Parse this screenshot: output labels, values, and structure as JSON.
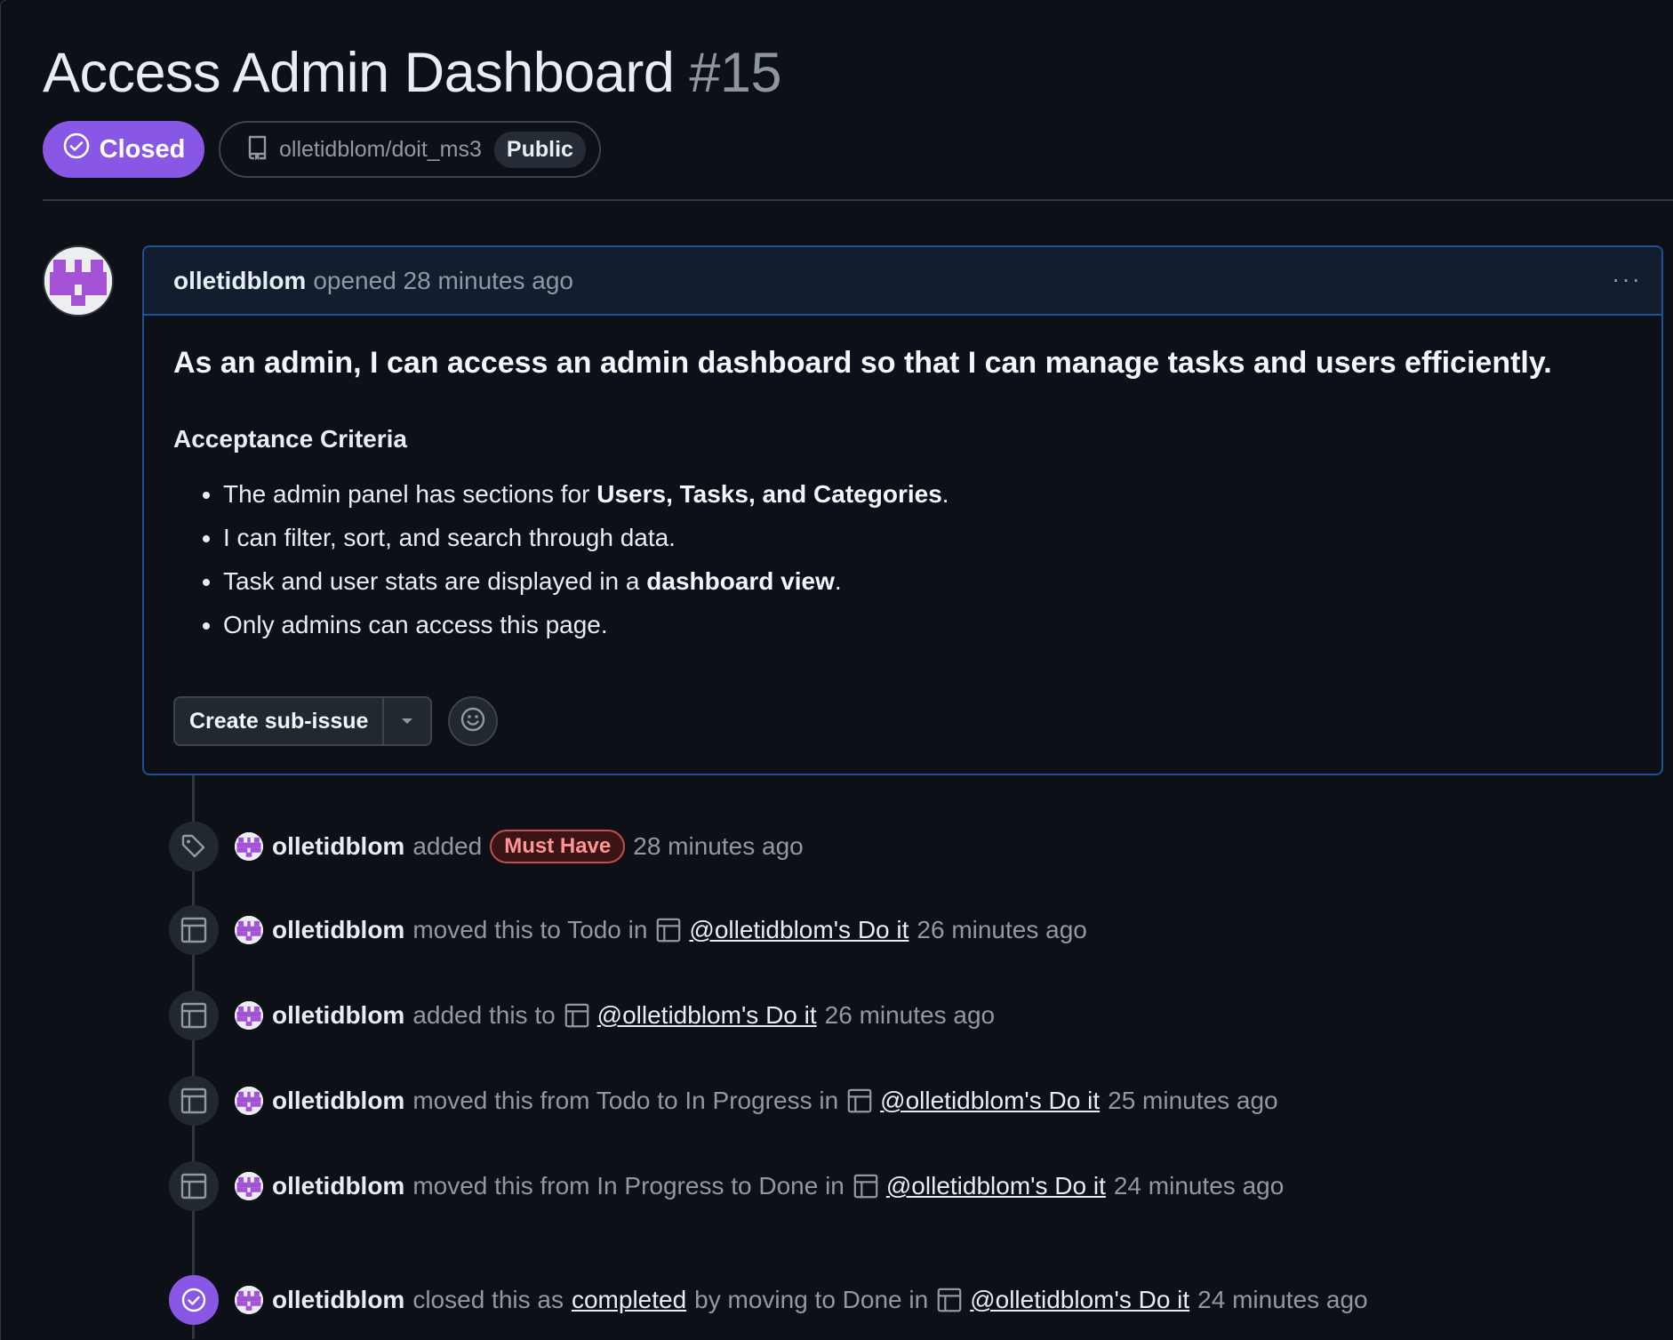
{
  "issue": {
    "title": "Access Admin Dashboard",
    "number": "#15",
    "state": "Closed",
    "repo": "olletidblom/doit_ms3",
    "visibility": "Public"
  },
  "comment": {
    "author": "olletidblom",
    "meta": "opened 28 minutes ago",
    "more": "···",
    "headline": "As an admin, I can access an admin dashboard so that I can manage tasks and users efficiently.",
    "section": "Acceptance Criteria",
    "criteria": [
      {
        "pre": "The admin panel has sections for ",
        "bold": "Users, Tasks, and Categories",
        "post": "."
      },
      {
        "pre": "I can filter, sort, and search through data.",
        "bold": "",
        "post": ""
      },
      {
        "pre": "Task and user stats are displayed in a ",
        "bold": "dashboard view",
        "post": "."
      },
      {
        "pre": "Only admins can access this page.",
        "bold": "",
        "post": ""
      }
    ],
    "create_sub_issue": "Create sub-issue"
  },
  "timeline": [
    {
      "icon": "tag-icon",
      "actor": "olletidblom",
      "text": "added",
      "label": "Must Have",
      "time": "28 minutes ago"
    },
    {
      "icon": "project-icon",
      "actor": "olletidblom",
      "text": "moved this to Todo in",
      "project": "@olletidblom's Do it",
      "time": "26 minutes ago"
    },
    {
      "icon": "project-icon",
      "actor": "olletidblom",
      "text": "added this to",
      "project": "@olletidblom's Do it",
      "time": "26 minutes ago"
    },
    {
      "icon": "project-icon",
      "actor": "olletidblom",
      "text": "moved this from Todo to In Progress in",
      "project": "@olletidblom's Do it",
      "time": "25 minutes ago"
    },
    {
      "icon": "project-icon",
      "actor": "olletidblom",
      "text": "moved this from In Progress to Done in",
      "project": "@olletidblom's Do it",
      "time": "24 minutes ago"
    },
    {
      "icon": "check-circle-icon",
      "actor": "olletidblom",
      "text": "closed this as",
      "link": "completed",
      "text2": "by moving to Done in",
      "project": "@olletidblom's Do it",
      "time": "24 minutes ago"
    }
  ],
  "colors": {
    "background": "#0d1117",
    "closed_purple": "#8957e5",
    "label_red": "#ff9492",
    "border_blue": "#1f4f96"
  }
}
